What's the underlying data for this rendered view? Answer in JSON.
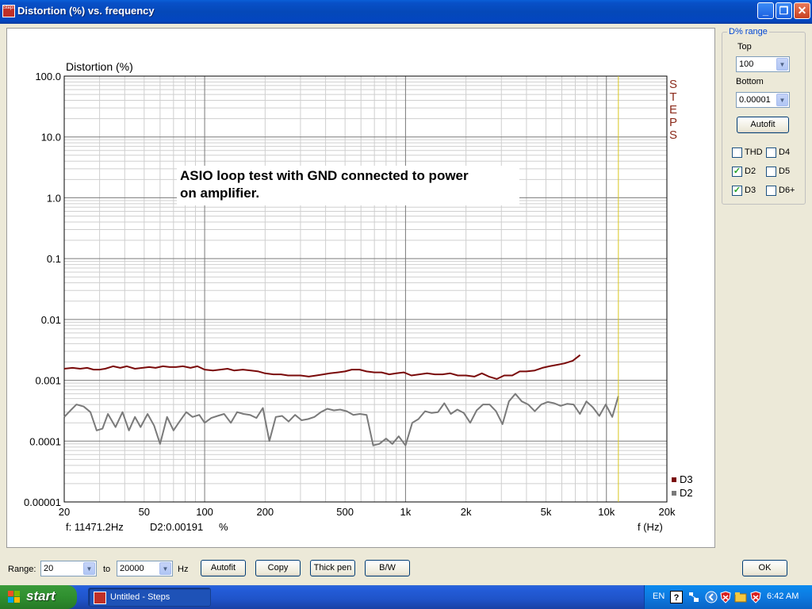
{
  "window": {
    "title": "Distortion (%) vs. frequency",
    "app_icon_text": "Steps"
  },
  "title_buttons": {
    "minimize": "_",
    "maximize": "❐",
    "close": "✕"
  },
  "chart_data": {
    "type": "line",
    "ylabel": "Distortion (%)",
    "xlabel": "f (Hz)",
    "xscale": "log",
    "yscale": "log",
    "xlim": [
      20,
      20000
    ],
    "ylim": [
      1e-05,
      100
    ],
    "x_ticks": [
      "20",
      "50",
      "100",
      "200",
      "500",
      "1k",
      "2k",
      "5k",
      "10k",
      "20k"
    ],
    "x_tick_values": [
      20,
      50,
      100,
      200,
      500,
      1000,
      2000,
      5000,
      10000,
      20000
    ],
    "y_ticks": [
      "100.0",
      "10.0",
      "1.0",
      "0.1",
      "0.01",
      "0.001",
      "0.0001",
      "0.00001"
    ],
    "y_tick_values": [
      100,
      10,
      1,
      0.1,
      0.01,
      0.001,
      0.0001,
      1e-05
    ],
    "grid": true,
    "annotation": "ASIO loop test with GND connected to power on amplifier.",
    "brand_text": "STEPS",
    "cursor": {
      "x": 11471.2,
      "readout_freq": "f: 11471.2Hz",
      "readout_value": "D2:0.00191",
      "readout_unit": "%",
      "color": "#d8c820"
    },
    "legend": [
      {
        "name": "D3",
        "color": "#7a0a0a"
      },
      {
        "name": "D2",
        "color": "#7a7a7a"
      }
    ],
    "series": [
      {
        "name": "D3",
        "color": "#7a0a0a",
        "x": [
          20,
          22,
          24,
          26,
          28,
          30,
          32,
          35,
          38,
          41,
          45,
          49,
          53,
          57,
          62,
          67,
          72,
          78,
          85,
          92,
          100,
          110,
          120,
          130,
          140,
          155,
          170,
          185,
          200,
          220,
          240,
          260,
          280,
          300,
          330,
          360,
          390,
          420,
          460,
          500,
          540,
          590,
          640,
          700,
          760,
          830,
          900,
          980,
          1070,
          1170,
          1280,
          1400,
          1530,
          1670,
          1820,
          2000,
          2200,
          2400,
          2600,
          2850,
          3100,
          3400,
          3700,
          4000,
          4400,
          4800,
          5200,
          5700,
          6200,
          6800,
          7400
        ],
        "y": [
          0.00155,
          0.0016,
          0.00155,
          0.0016,
          0.0015,
          0.0015,
          0.00155,
          0.0017,
          0.0016,
          0.0017,
          0.00155,
          0.0016,
          0.00165,
          0.0016,
          0.0017,
          0.00165,
          0.00165,
          0.0017,
          0.0016,
          0.0017,
          0.0015,
          0.00145,
          0.0015,
          0.00155,
          0.00145,
          0.0015,
          0.00145,
          0.0014,
          0.0013,
          0.00125,
          0.00125,
          0.0012,
          0.0012,
          0.0012,
          0.00115,
          0.0012,
          0.00125,
          0.0013,
          0.00135,
          0.0014,
          0.0015,
          0.0015,
          0.0014,
          0.00135,
          0.00135,
          0.00125,
          0.0013,
          0.00135,
          0.0012,
          0.00125,
          0.0013,
          0.00125,
          0.00125,
          0.0013,
          0.0012,
          0.0012,
          0.00115,
          0.0013,
          0.00115,
          0.00105,
          0.0012,
          0.0012,
          0.0014,
          0.0014,
          0.00145,
          0.0016,
          0.0017,
          0.0018,
          0.0019,
          0.0021,
          0.0026
        ]
      },
      {
        "name": "D2",
        "color": "#7a7a7a",
        "x": [
          20,
          21.5,
          23,
          25,
          27,
          29,
          31,
          33,
          36,
          39,
          42,
          45,
          48,
          52,
          56,
          60,
          65,
          70,
          75,
          81,
          87,
          94,
          100,
          108,
          116,
          125,
          135,
          145,
          156,
          168,
          181,
          195,
          210,
          226,
          243,
          262,
          282,
          304,
          327,
          352,
          379,
          408,
          440,
          473,
          510,
          550,
          593,
          640,
          690,
          740,
          800,
          860,
          925,
          1000,
          1080,
          1160,
          1250,
          1350,
          1450,
          1560,
          1680,
          1810,
          1950,
          2100,
          2260,
          2430,
          2620,
          2820,
          3040,
          3270,
          3520,
          3790,
          4080,
          4400,
          4740,
          5100,
          5490,
          5910,
          6370,
          6860,
          7380,
          7950,
          8560,
          9220,
          9920,
          10690,
          11471
        ],
        "y": [
          0.00025,
          0.00032,
          0.0004,
          0.00037,
          0.0003,
          0.00015,
          0.00016,
          0.00028,
          0.00017,
          0.0003,
          0.00015,
          0.00025,
          0.00017,
          0.00028,
          0.00018,
          9e-05,
          0.00025,
          0.00015,
          0.00021,
          0.0003,
          0.00025,
          0.00027,
          0.0002,
          0.00024,
          0.00026,
          0.00028,
          0.0002,
          0.0003,
          0.00028,
          0.00027,
          0.00024,
          0.00035,
          0.0001,
          0.00025,
          0.00026,
          0.00021,
          0.00027,
          0.00022,
          0.00023,
          0.00025,
          0.0003,
          0.00034,
          0.00032,
          0.00033,
          0.00031,
          0.00027,
          0.00028,
          0.00027,
          8.5e-05,
          9e-05,
          0.00011,
          9e-05,
          0.00012,
          8.5e-05,
          0.0002,
          0.00023,
          0.00031,
          0.00029,
          0.0003,
          0.00042,
          0.00028,
          0.00033,
          0.00029,
          0.0002,
          0.00032,
          0.0004,
          0.0004,
          0.00031,
          0.00019,
          0.00045,
          0.0006,
          0.00045,
          0.0004,
          0.00031,
          0.0004,
          0.00044,
          0.00042,
          0.00038,
          0.00041,
          0.0004,
          0.00028,
          0.00045,
          0.00036,
          0.00026,
          0.0004,
          0.00025,
          0.00055
        ]
      }
    ]
  },
  "drange": {
    "legend": "D% range",
    "top_label": "Top",
    "top_value": "100",
    "bottom_label": "Bottom",
    "bottom_value": "0.00001",
    "autofit_label": "Autofit",
    "checkboxes": [
      {
        "label": "THD",
        "checked": false
      },
      {
        "label": "D4",
        "checked": false
      },
      {
        "label": "D2",
        "checked": true
      },
      {
        "label": "D5",
        "checked": false
      },
      {
        "label": "D3",
        "checked": true
      },
      {
        "label": "D6+",
        "checked": false
      }
    ]
  },
  "bottom": {
    "range_label": "Range:",
    "range_from": "20",
    "to_label": "to",
    "range_to": "20000",
    "hz_label": "Hz",
    "autofit_label": "Autofit",
    "copy_label": "Copy",
    "thick_pen_label": "Thick pen",
    "bw_label": "B/W",
    "ok_label": "OK"
  },
  "taskbar": {
    "start_label": "start",
    "task_item_label": "Untitled - Steps",
    "lang": "EN",
    "help_glyph": "?",
    "clock": "6:42 AM"
  },
  "colors": {
    "title_bar": "#0548b8",
    "taskbar": "#245edc",
    "start_green": "#2f8f2f",
    "d3": "#7a0a0a",
    "d2": "#7a7a7a",
    "cursor": "#d8c820",
    "steps_brand": "#8b2a1a"
  }
}
